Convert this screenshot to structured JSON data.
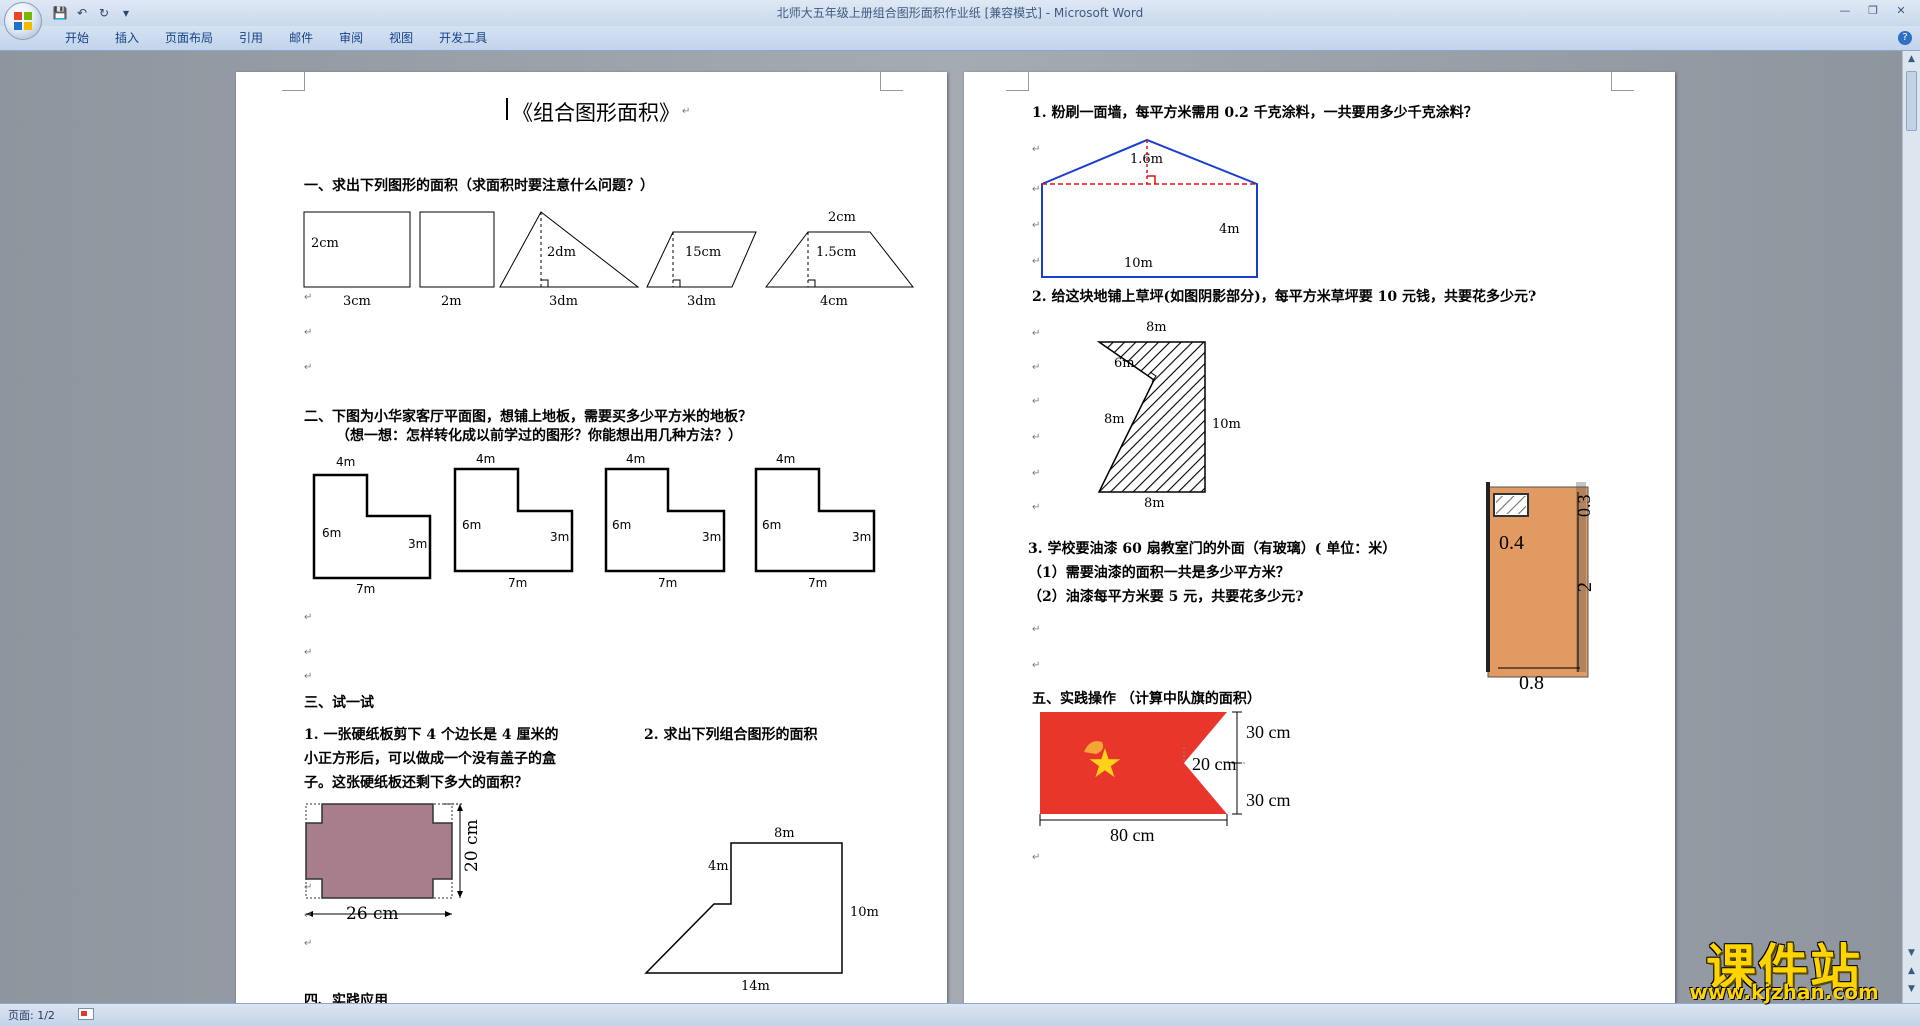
{
  "window": {
    "title": "北师大五年级上册组合图形面积作业纸 [兼容模式] - Microsoft Word",
    "qat": {
      "save_glyph": "💾",
      "undo_glyph": "↶",
      "redo_glyph": "↻",
      "more_glyph": "▾"
    },
    "controls": {
      "minimize": "—",
      "maximize": "❐",
      "close": "✕"
    }
  },
  "ribbon": {
    "tabs": [
      "开始",
      "插入",
      "页面布局",
      "引用",
      "邮件",
      "审阅",
      "视图",
      "开发工具"
    ],
    "help": "?"
  },
  "statusbar": {
    "page": "页面: 1/2"
  },
  "scrollbar": {
    "up": "▲",
    "down": "▼",
    "prev": "▲",
    "next": "▼"
  },
  "mark": "↵",
  "page1": {
    "title": "《组合图形面积》",
    "sec1": {
      "heading": "一、求出下列图形的面积（求面积时要注意什么问题？）",
      "rect": {
        "side": "2cm",
        "bottom": "3cm"
      },
      "square": {
        "bottom": "2m"
      },
      "triangle": {
        "height": "2dm",
        "bottom": "3dm"
      },
      "parallelogram": {
        "height": "15cm",
        "bottom": "3dm"
      },
      "trapezoid": {
        "top": "2cm",
        "height": "1.5cm",
        "bottom": "4cm"
      }
    },
    "sec2": {
      "heading": "二、下图为小华家客厅平面图，想铺上地板，需要买多少平方米的地板？",
      "hint": "（想一想：怎样转化成以前学过的图形？你能想出用几种方法？）",
      "labels": {
        "top": "4m",
        "left": "6m",
        "right": "3m",
        "bottom": "7m"
      }
    },
    "sec3": {
      "heading": "三、试一试",
      "q1_line1": "1. 一张硬纸板剪下 4 个边长是 4 厘米的",
      "q1_line2": "小正方形后，可以做成一个没有盖子的盒",
      "q1_line3": "子。这张硬纸板还剩下多大的面积？",
      "card": {
        "width": "26 cm",
        "height": "20 cm"
      },
      "q2": "2. 求出下列组合图形的面积",
      "shape": {
        "top": "8m",
        "left": "4m",
        "right": "10m",
        "bottom": "14m"
      }
    },
    "sec4": {
      "heading": "四、实践应用"
    }
  },
  "page2": {
    "q1": "1. 粉刷一面墙，每平方米需用 0.2 千克涂料，一共要用多少千克涂料？",
    "wall": {
      "peak": "1.6m",
      "side": "4m",
      "bottom": "10m"
    },
    "q2": "2. 给这块地铺上草坪(如图阴影部分)，每平方米草坪要 10 元钱，共要花多少元?",
    "lawn": {
      "top": "8m",
      "notch": "6m",
      "left": "8m",
      "right": "10m",
      "bottom": "8m"
    },
    "q3": "3. 学校要油漆 60 扇教室门的外面（有玻璃）( 单位：米）",
    "q3a": "（1）需要油漆的面积一共是多少平方米？",
    "q3b": "（2）油漆每平方米要 5 元，共要花多少元?",
    "door": {
      "glass": "0.4",
      "glass_h": "0.3",
      "height": "2",
      "width": "0.8"
    },
    "sec5": "五、实践操作 （计算中队旗的面积）",
    "flag": {
      "upper": "30 cm",
      "notch": "20 cm",
      "lower": "30 cm",
      "width": "80 cm",
      "star": "★"
    }
  },
  "watermark": {
    "big": "课件站",
    "small": "www.kjzhan.com"
  },
  "colors": {
    "ribbon_text": "#15428b",
    "wall_line": "#1a3fd0",
    "dash_red": "#e01010",
    "card": "#a87d8c",
    "door": "#e09a62",
    "flag": "#e8372a",
    "watermark": "#ffd400"
  }
}
